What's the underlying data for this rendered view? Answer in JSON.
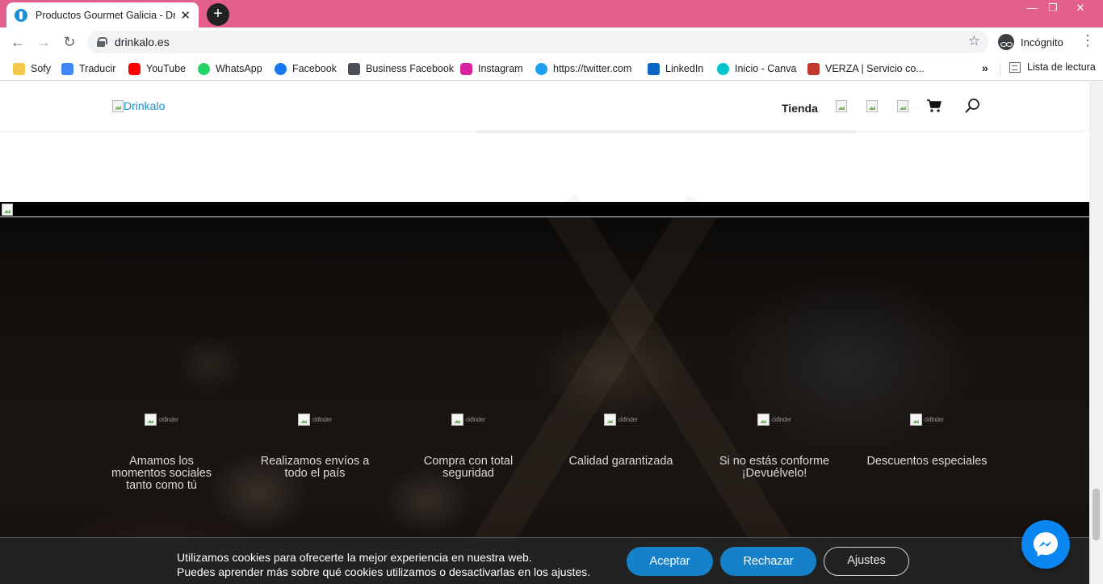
{
  "browser": {
    "tab_title": "Productos Gourmet Galicia - Drinkalo",
    "tab_close": "✕",
    "new_tab": "+",
    "url": "drinkalo.es",
    "incognito_label": "Incógnito",
    "window_controls": {
      "minimize": "—",
      "restore": "❐",
      "close": "✕"
    },
    "nav_icons": {
      "back": "←",
      "forward": "→",
      "reload": "↻",
      "star": "☆",
      "menu": "⋮"
    }
  },
  "bookmarks": {
    "items": [
      {
        "label": "Sofy",
        "icon": "folder-icon",
        "color": "#f4c84a"
      },
      {
        "label": "Traducir",
        "icon": "translate-icon",
        "color": "#4285f4"
      },
      {
        "label": "YouTube",
        "icon": "youtube-icon",
        "color": "#ff0000"
      },
      {
        "label": "WhatsApp",
        "icon": "whatsapp-icon",
        "color": "#25d366"
      },
      {
        "label": "Facebook",
        "icon": "facebook-icon",
        "color": "#1877f2"
      },
      {
        "label": "Business Facebook",
        "icon": "business-facebook-icon",
        "color": "#4a4f57"
      },
      {
        "label": "Instagram",
        "icon": "instagram-icon",
        "color": "#d6249f"
      },
      {
        "label": "https://twitter.com",
        "icon": "twitter-icon",
        "color": "#1da1f2"
      },
      {
        "label": "LinkedIn",
        "icon": "linkedin-icon",
        "color": "#0a66c2"
      },
      {
        "label": "Inicio - Canva",
        "icon": "canva-icon",
        "color": "#00c4cc"
      },
      {
        "label": "VERZA | Servicio co...",
        "icon": "verza-icon",
        "color": "#c0392b"
      }
    ],
    "more": "»",
    "reading_list": "Lista de lectura"
  },
  "site": {
    "logo_alt": "Drinkalo",
    "nav": {
      "shop": "Tienda"
    },
    "features": [
      {
        "text": "Amamos los momentos sociales tanto como tú",
        "alt": "ckfinder"
      },
      {
        "text": "Realizamos envíos a todo el país",
        "alt": "ckfinder"
      },
      {
        "text": "Compra con total seguridad",
        "alt": "ckfinder"
      },
      {
        "text": "Calidad garantizada",
        "alt": "ckfinder"
      },
      {
        "text": "Si no estás conforme ¡Devuélvelo!",
        "alt": "ckfinder"
      },
      {
        "text": "Descuentos especiales",
        "alt": "ckfinder"
      }
    ],
    "cookie": {
      "line1": "Utilizamos cookies para ofrecerte la mejor experiencia en nuestra web.",
      "line2": "Puedes aprender más sobre qué cookies utilizamos o desactivarlas en los ajustes.",
      "accept": "Aceptar",
      "reject": "Rechazar",
      "settings": "Ajustes"
    }
  },
  "colors": {
    "titlebar": "#e4608c",
    "accent": "#1680c8",
    "messenger": "#0a86f0"
  }
}
